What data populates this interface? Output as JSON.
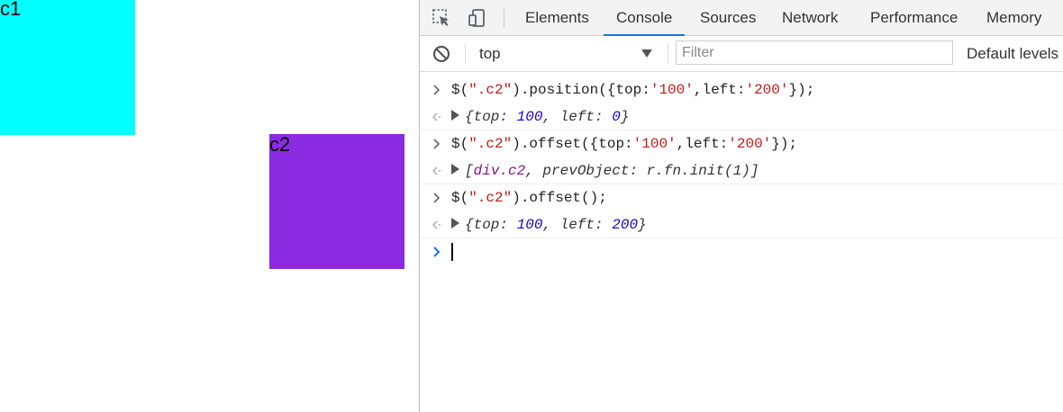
{
  "page": {
    "c1_label": "c1",
    "c2_label": "c2",
    "c1_color": "#00ffff",
    "c2_color": "#8a2be2"
  },
  "devtools": {
    "tabs": [
      "Elements",
      "Console",
      "Sources",
      "Network",
      "Performance",
      "Memory"
    ],
    "active_tab": "Console",
    "accent": "#1a73e8",
    "toolbar": {
      "context": "top",
      "filter_placeholder": "Filter",
      "levels": "Default levels"
    },
    "icons": [
      "inspect-element-icon",
      "device-toolbar-icon",
      "clear-console-icon",
      "dropdown-arrow-icon"
    ]
  },
  "console": {
    "entries": [
      {
        "input_parts": [
          "$(",
          "\".c2\"",
          ").position({top:",
          "'100'",
          ",left:",
          "'200'",
          "});"
        ],
        "result_parts": [
          "{top: ",
          "100",
          ", left: ",
          "0",
          "}"
        ]
      },
      {
        "input_parts": [
          "$(",
          "\".c2\"",
          ").offset({top:",
          "'100'",
          ",left:",
          "'200'",
          "});"
        ],
        "result_parts": [
          "[",
          "div.c2",
          ", prevObject: r.fn.init(1)]"
        ]
      },
      {
        "input_parts": [
          "$(",
          "\".c2\"",
          ").offset();"
        ],
        "result_parts": [
          "{top: ",
          "100",
          ", left: ",
          "200",
          "}"
        ]
      }
    ]
  }
}
